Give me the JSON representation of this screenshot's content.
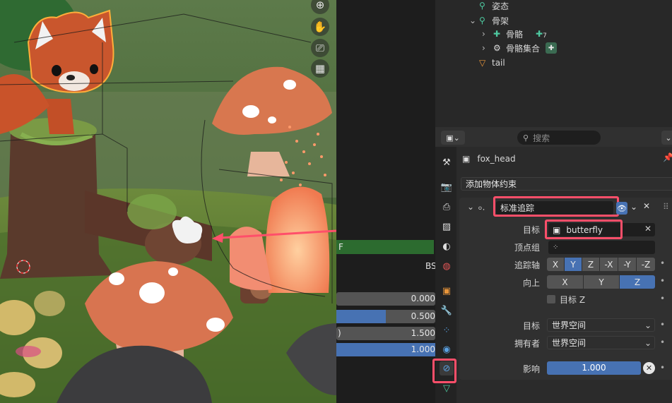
{
  "outliner": {
    "items": [
      {
        "label": "姿态"
      },
      {
        "label": "骨架"
      },
      {
        "label": "骨骼",
        "badge": "7"
      },
      {
        "label": "骨骼集合"
      },
      {
        "label": "tail"
      }
    ]
  },
  "properties": {
    "search_placeholder": "搜索",
    "object_name": "fox_head",
    "add_constraint_label": "添加物体约束",
    "constraint": {
      "name": "标准追踪",
      "target_label": "目标",
      "target_value": "butterfly",
      "vertex_group_label": "顶点组",
      "track_axis_label": "追踪轴",
      "track_axis_options": [
        "X",
        "Y",
        "Z",
        "-X",
        "-Y",
        "-Z"
      ],
      "track_axis_selected": "Y",
      "up_label": "向上",
      "up_options": [
        "X",
        "Y",
        "Z"
      ],
      "up_selected": "Z",
      "target_z_label": "目标 Z",
      "target_space_label": "目标",
      "target_space_value": "世界空间",
      "owner_space_label": "拥有者",
      "owner_space_value": "世界空间",
      "influence_label": "影响",
      "influence_value": "1.000",
      "influence_fraction": 1.0
    }
  },
  "midpanel": {
    "header_letter": "F",
    "bs_label": "BS",
    "values": [
      {
        "text": "0.000",
        "fill": 0.0
      },
      {
        "text": "0.500",
        "fill": 0.5
      },
      {
        "text": "1.500",
        "fill": 0.0
      },
      {
        "text": "1.000",
        "fill": 1.0
      }
    ],
    "paren": ")"
  },
  "colors": {
    "accent_blue": "#4772b3",
    "highlight_red": "#ff4f6a",
    "bone_green": "#4ec9a0",
    "mid_header_green": "#2c6b2f"
  }
}
